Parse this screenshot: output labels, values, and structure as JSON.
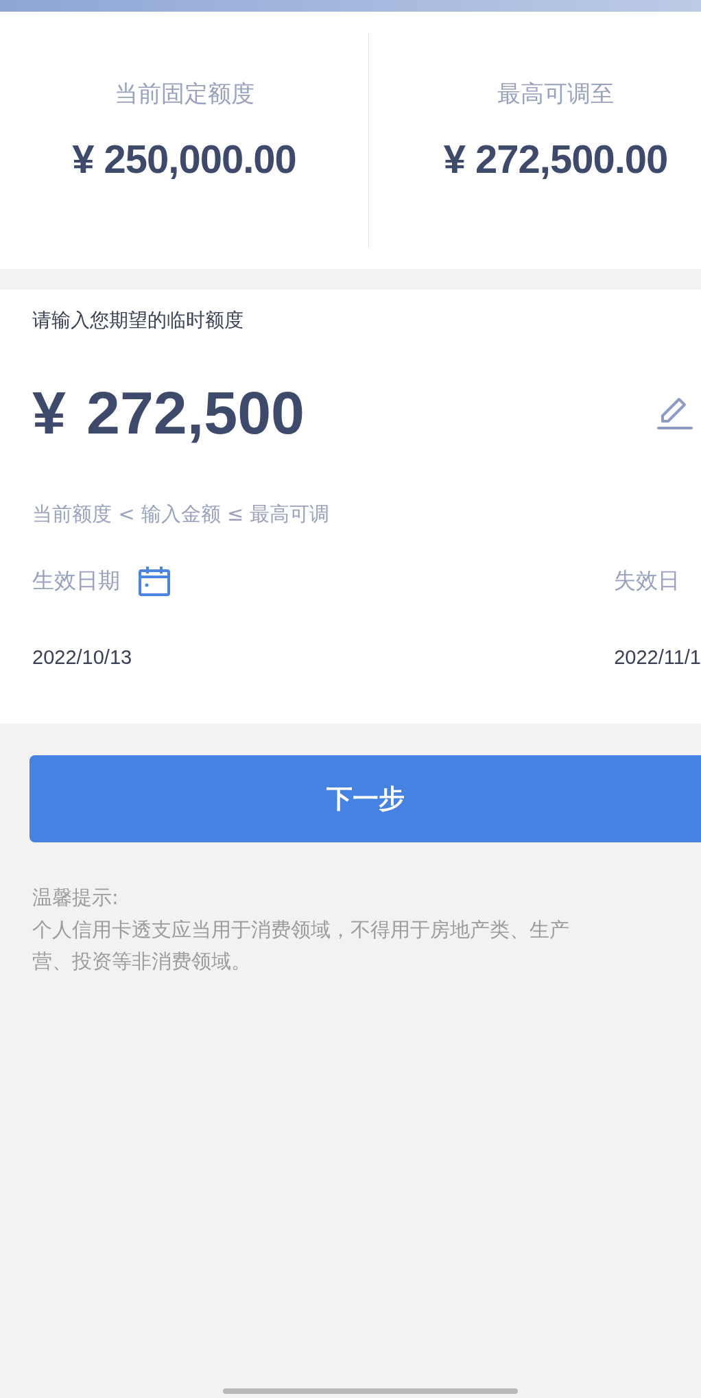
{
  "quota": [
    {
      "label": "当前固定额度",
      "amount": "¥ 250,000.00"
    },
    {
      "label": "最高可调至",
      "amount": "¥ 272,500.00"
    }
  ],
  "amount_input": {
    "label": "请输入您期望的临时额度",
    "currency": "¥",
    "value": "272,500",
    "hint": "当前额度 < 输入金额 ≤ 最高可调"
  },
  "dates": [
    {
      "kind": "picker",
      "label": "生效日期",
      "value": "2022/10/13"
    },
    {
      "kind": "plain",
      "label": "失效日",
      "value": "2022/11/1"
    }
  ],
  "next_button": "下一步",
  "tip": {
    "title": "温馨提示:",
    "lines": [
      "个人信用卡透支应当用于消费领域，不得用于房地产类、生产",
      "营、投资等非消费领域。"
    ]
  }
}
